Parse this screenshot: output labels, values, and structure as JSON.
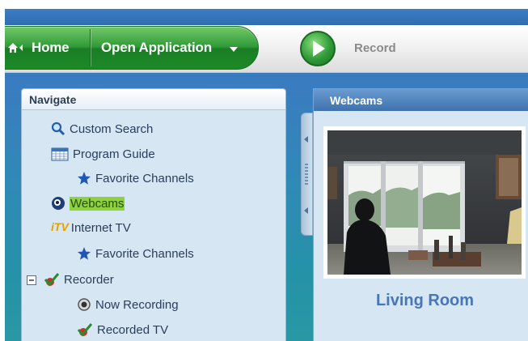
{
  "toolbar": {
    "home_label": "Home",
    "open_application_label": "Open Application",
    "record_label": "Record"
  },
  "navigate": {
    "title": "Navigate",
    "items": [
      {
        "label": "Custom Search",
        "icon": "search-icon"
      },
      {
        "label": "Program Guide",
        "icon": "calendar-grid-icon"
      },
      {
        "label": "Favorite Channels",
        "icon": "star-icon"
      },
      {
        "label": "Webcams",
        "icon": "webcam-icon",
        "selected": true
      },
      {
        "label": "Internet TV",
        "icon": "itv-logo-icon"
      },
      {
        "label": "Favorite Channels",
        "icon": "star-icon"
      },
      {
        "label": "Recorder",
        "icon": "checkmark-icon",
        "expanded": true
      },
      {
        "label": "Now Recording",
        "icon": "record-dot-icon"
      },
      {
        "label": "Recorded TV",
        "icon": "checkmark-icon"
      }
    ],
    "itv_logo_text": "iTV"
  },
  "webcams": {
    "title": "Webcams",
    "camera_name": "Living Room"
  },
  "colors": {
    "app_background": "#2f7cb8",
    "green_accent": "#2f9a37",
    "selection_highlight": "#8ed33b",
    "camera_label": "#4777b8"
  }
}
